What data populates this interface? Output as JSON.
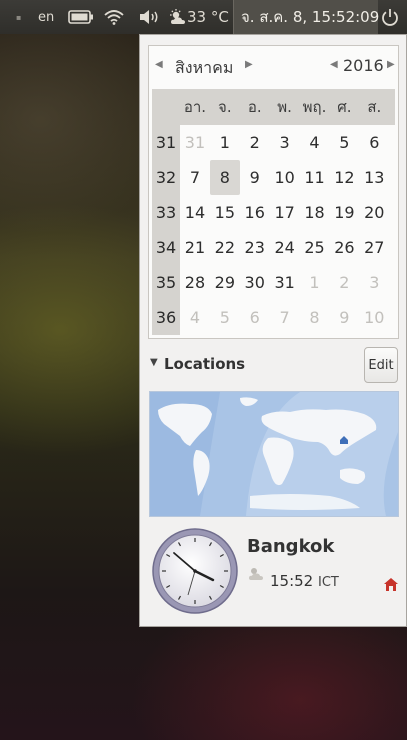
{
  "panel": {
    "keyboard_layout": "en",
    "temperature": "33 °C",
    "datetime": "จ. ส.ค.  8, 15:52:09"
  },
  "calendar": {
    "month": "สิงหาคม",
    "year": "2016",
    "weekdays": [
      "อา.",
      "จ.",
      "อ.",
      "พ.",
      "พฤ.",
      "ศ.",
      "ส."
    ],
    "weeks": [
      {
        "num": "31",
        "days": [
          "31",
          "1",
          "2",
          "3",
          "4",
          "5",
          "6"
        ]
      },
      {
        "num": "32",
        "days": [
          "7",
          "8",
          "9",
          "10",
          "11",
          "12",
          "13"
        ]
      },
      {
        "num": "33",
        "days": [
          "14",
          "15",
          "16",
          "17",
          "18",
          "19",
          "20"
        ]
      },
      {
        "num": "34",
        "days": [
          "21",
          "22",
          "23",
          "24",
          "25",
          "26",
          "27"
        ]
      },
      {
        "num": "35",
        "days": [
          "28",
          "29",
          "30",
          "31",
          "1",
          "2",
          "3"
        ]
      },
      {
        "num": "36",
        "days": [
          "4",
          "5",
          "6",
          "7",
          "8",
          "9",
          "10"
        ]
      }
    ],
    "selected_day": "8"
  },
  "locations": {
    "title": "Locations",
    "edit_label": "Edit",
    "city": "Bangkok",
    "time": "15:52",
    "timezone": "ICT"
  },
  "colors": {
    "panel": "#3c3b37",
    "accent_home": "#c7342b",
    "map_water": "#9fbde2",
    "map_land": "#f4f6f9"
  }
}
